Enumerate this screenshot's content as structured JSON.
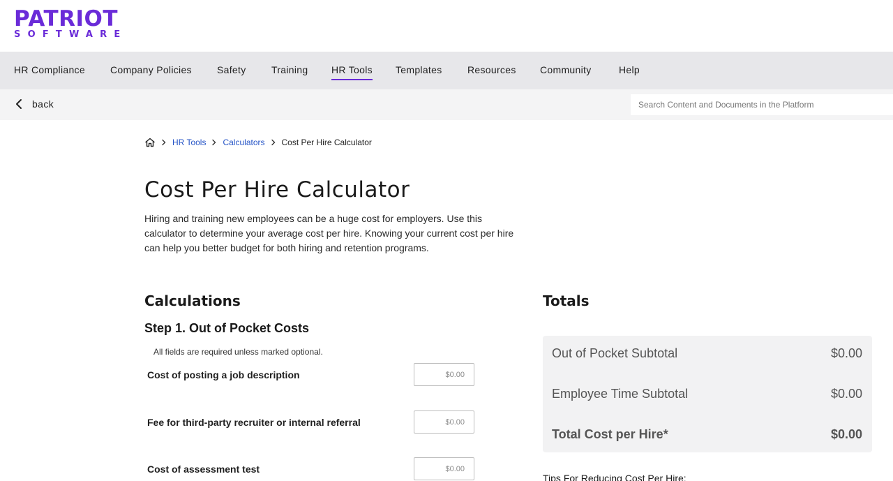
{
  "logo": {
    "line1": "PATRIOT",
    "line2": "SOFTWARE"
  },
  "nav": {
    "items": [
      {
        "label": "HR Compliance"
      },
      {
        "label": "Company Policies"
      },
      {
        "label": "Safety"
      },
      {
        "label": "Training"
      },
      {
        "label": "HR Tools",
        "active": true
      },
      {
        "label": "Templates"
      },
      {
        "label": "Resources"
      },
      {
        "label": "Community"
      },
      {
        "label": "Help"
      }
    ]
  },
  "subbar": {
    "back_label": "back",
    "search_placeholder": "Search Content and Documents in the Platform"
  },
  "breadcrumb": {
    "home_icon": "home-icon",
    "items": [
      {
        "label": "HR Tools"
      },
      {
        "label": "Calculators"
      },
      {
        "label": "Cost Per Hire Calculator"
      }
    ]
  },
  "page": {
    "title": "Cost Per Hire Calculator",
    "intro": "Hiring and training new employees can be a huge cost for employers. Use this calculator to determine your average cost per hire. Knowing your current cost per hire can help you better budget for both hiring and retention programs."
  },
  "calculations": {
    "heading": "Calculations",
    "step_heading": "Step 1. Out of Pocket Costs",
    "required_note": "All fields are required unless marked optional.",
    "fields": [
      {
        "label": "Cost of posting a job description",
        "placeholder": "$0.00"
      },
      {
        "label": "Fee for third-party recruiter or internal referral",
        "placeholder": "$0.00"
      },
      {
        "label": "Cost of assessment test",
        "placeholder": "$0.00"
      }
    ]
  },
  "totals": {
    "heading": "Totals",
    "rows": [
      {
        "label": "Out of Pocket Subtotal",
        "value": "$0.00"
      },
      {
        "label": "Employee Time Subtotal",
        "value": "$0.00"
      },
      {
        "label": "Total Cost per Hire*",
        "value": "$0.00"
      }
    ],
    "tips_heading": "Tips For Reducing Cost Per Hire:"
  },
  "colors": {
    "brand": "#6a2bd8",
    "link": "#2453c6",
    "nav_bg": "#e7e7ea"
  }
}
